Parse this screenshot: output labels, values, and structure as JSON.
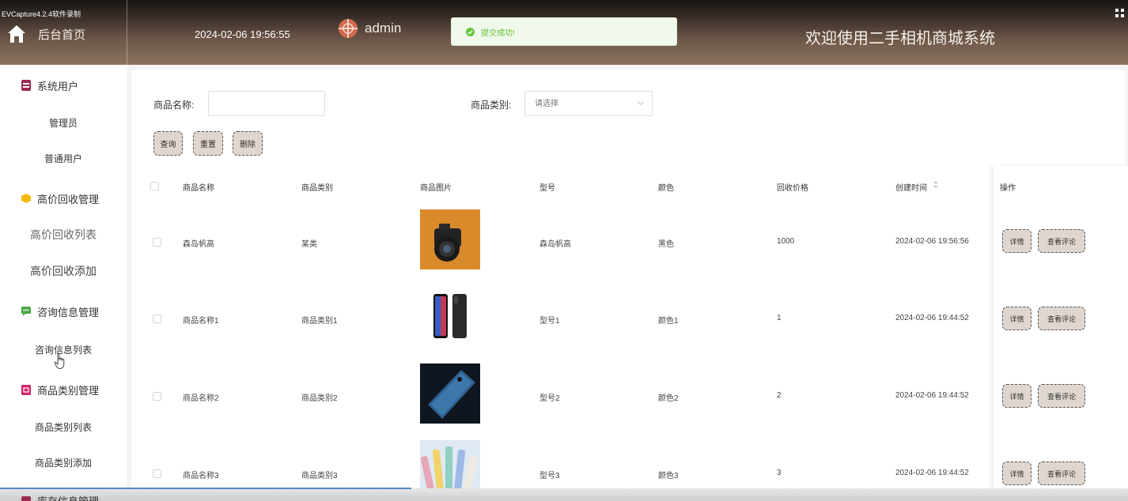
{
  "header": {
    "watermark": "EVCapture4.2.4软件录制",
    "home_label": "后台首页",
    "datetime": "2024-02-06 19:56:55",
    "admin_name": "admin",
    "toast": "提交成功!",
    "site_title": "欢迎使用二手相机商城系统"
  },
  "sidebar": {
    "items": [
      {
        "label": "系统用户",
        "icon": "user-box-icon"
      },
      {
        "label": "管理员"
      },
      {
        "label": "普通用户"
      },
      {
        "label": "高价回收管理",
        "icon": "cube-icon"
      },
      {
        "label": "高价回收列表"
      },
      {
        "label": "高价回收添加"
      },
      {
        "label": "咨询信息管理",
        "icon": "chat-icon"
      },
      {
        "label": "咨询信息列表"
      },
      {
        "label": "商品类别管理",
        "icon": "category-icon"
      },
      {
        "label": "商品类别列表"
      },
      {
        "label": "商品类别添加"
      },
      {
        "label": "库存信息管理",
        "icon": "storage-icon"
      }
    ]
  },
  "search": {
    "name_label": "商品名称:",
    "type_label": "商品类别:",
    "type_placeholder": "请选择",
    "query_btn": "查询",
    "reset_btn": "重置",
    "delete_btn": "删除"
  },
  "table": {
    "columns": [
      "商品名称",
      "商品类别",
      "商品图片",
      "型号",
      "颜色",
      "回收价格",
      "创建时间",
      "操作"
    ],
    "rows": [
      {
        "name": "森岛帆高",
        "category": "某类",
        "image": "camera-image",
        "model": "森岛帆高",
        "color": "黑色",
        "price": "1000",
        "created": "2024-02-06 19:56:56"
      },
      {
        "name": "商品名称1",
        "category": "商品类别1",
        "image": "phone-image",
        "model": "型号1",
        "color": "颜色1",
        "price": "1",
        "created": "2024-02-06 19:44:52"
      },
      {
        "name": "商品名称2",
        "category": "商品类别2",
        "image": "blue-phone-image",
        "model": "型号2",
        "color": "颜色2",
        "price": "2",
        "created": "2024-02-06 19:44:52"
      },
      {
        "name": "商品名称3",
        "category": "商品类别3",
        "image": "colorful-phones-image",
        "model": "型号3",
        "color": "颜色3",
        "price": "3",
        "created": "2024-02-06 19:44:52"
      }
    ],
    "detail_btn": "详情",
    "comment_btn": "查看评论"
  },
  "colors": {
    "header_brown": "#8b735f",
    "button_bg": "#dfd6cf",
    "success_green": "#67c23a"
  }
}
